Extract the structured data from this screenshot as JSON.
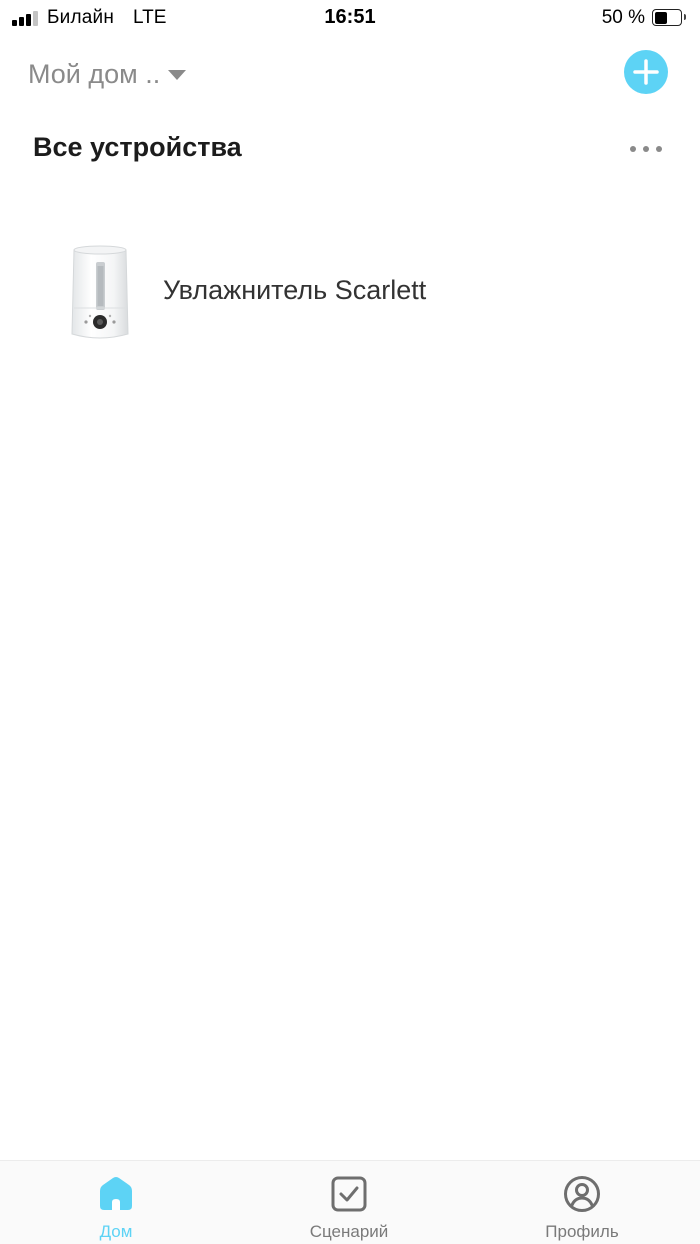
{
  "status_bar": {
    "carrier": "Билайн",
    "network": "LTE",
    "time": "16:51",
    "battery_text": "50 %",
    "battery_level": 0.5,
    "signal_bars_active": 3,
    "signal_bars_total": 4
  },
  "header": {
    "home_name": "Мой дом ..",
    "home_caret_icon": "caret-down-icon",
    "add_icon": "plus-icon"
  },
  "section": {
    "title": "Все устройства",
    "more_icon": "more-dots-icon"
  },
  "devices": [
    {
      "name": "Увлажнитель Scarlett",
      "icon": "humidifier-image"
    }
  ],
  "tab_bar": {
    "tabs": [
      {
        "label": "Дом",
        "icon": "home-icon",
        "active": true
      },
      {
        "label": "Сценарий",
        "icon": "checkbox-icon",
        "active": false
      },
      {
        "label": "Профиль",
        "icon": "profile-icon",
        "active": false
      }
    ]
  },
  "colors": {
    "accent": "#5dd3f5",
    "muted_text": "#8a8a8a",
    "title_text": "#1c1c1c",
    "device_text": "#333333",
    "inactive_tab": "#7a7a7a"
  }
}
